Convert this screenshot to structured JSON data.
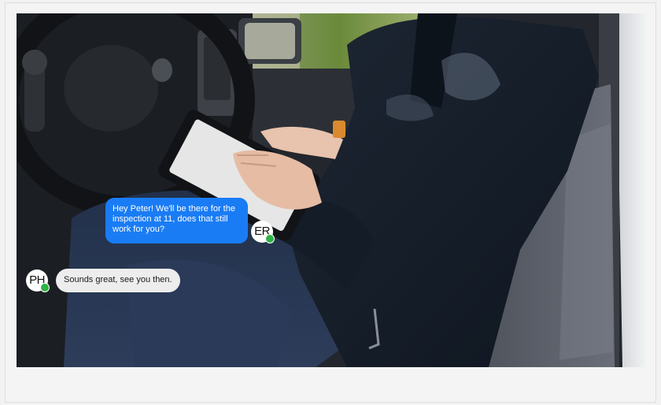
{
  "chat": {
    "outgoing": {
      "avatar_initials": "ER",
      "message": "Hey Peter! We'll be there for the inspection at 11, does that still work for you?"
    },
    "incoming": {
      "avatar_initials": "PH",
      "message": "Sounds great, see you then."
    }
  },
  "colors": {
    "outgoing_bubble": "#1a7cf5",
    "incoming_bubble": "#ededed",
    "presence_online": "#2fb344"
  },
  "icons": [
    "presence-dot-icon"
  ]
}
